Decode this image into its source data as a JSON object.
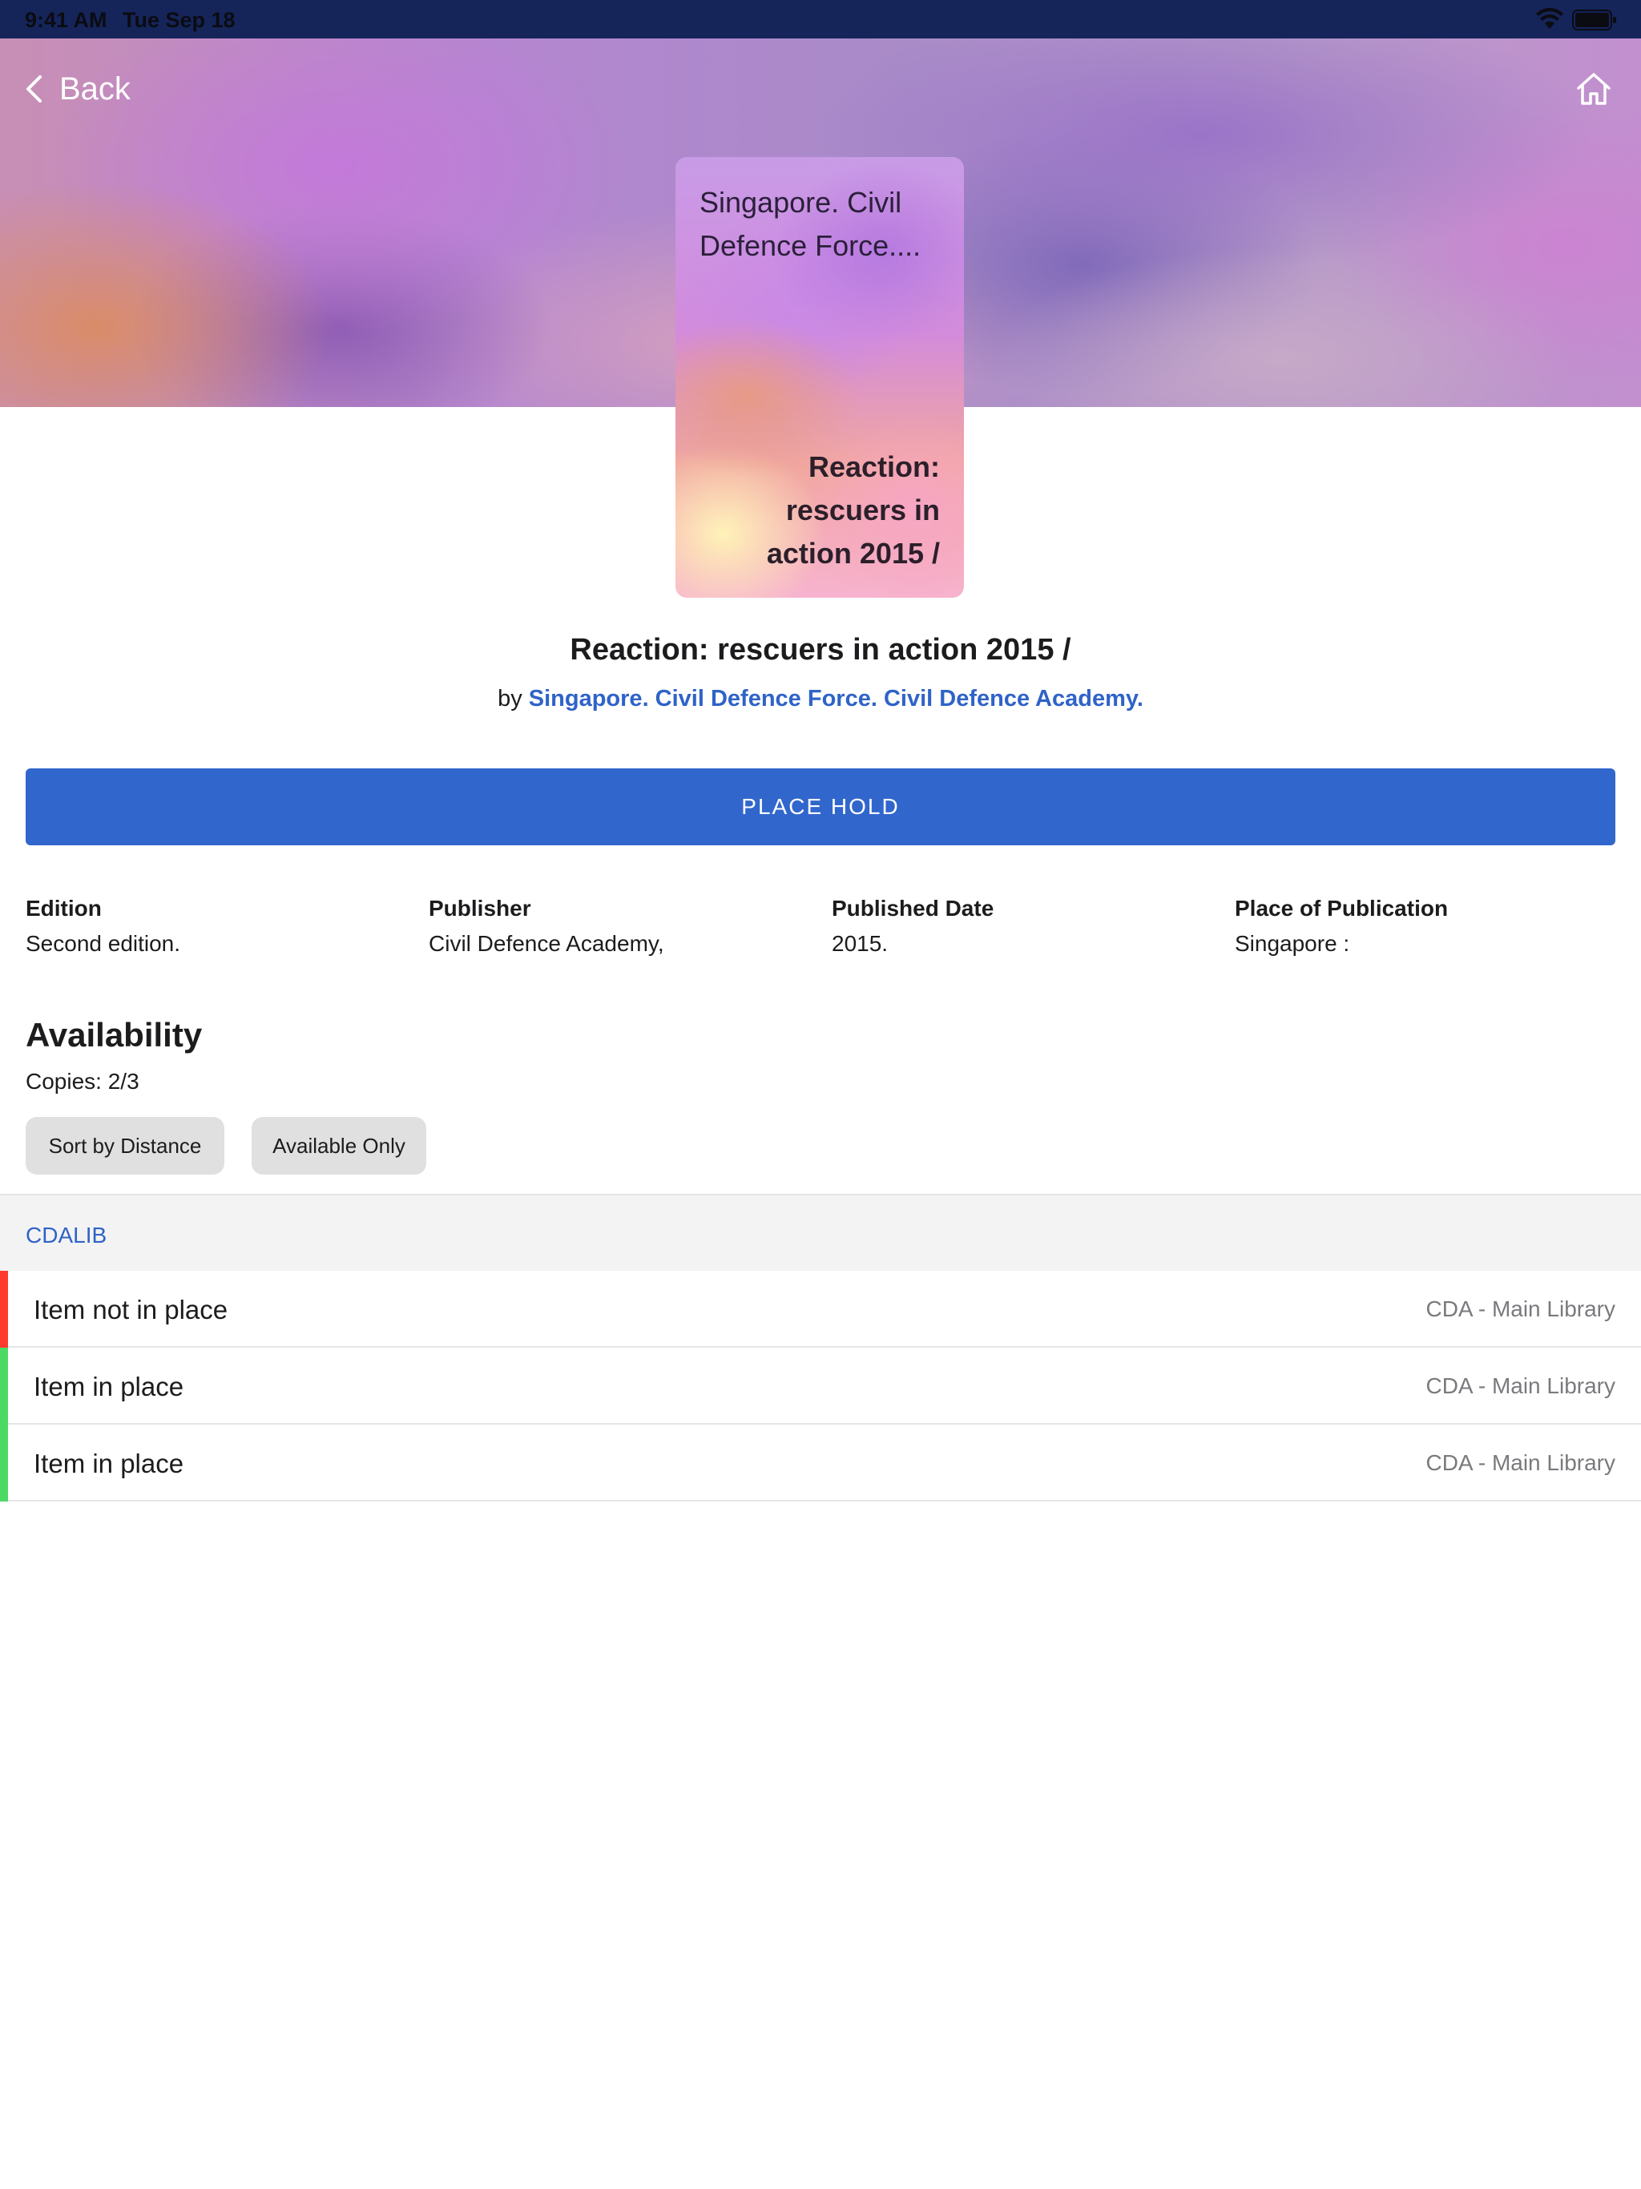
{
  "status_bar": {
    "time": "9:41 AM",
    "date": "Tue Sep 18"
  },
  "nav": {
    "back_label": "Back"
  },
  "cover": {
    "author_text": "Singapore. Civil Defence Force....",
    "title_text": "Reaction: rescuers in action 2015 /"
  },
  "book": {
    "title": "Reaction: rescuers in action 2015 /",
    "by_prefix": "by",
    "author": "Singapore. Civil Defence Force. Civil Defence Academy."
  },
  "actions": {
    "place_hold": "PLACE HOLD"
  },
  "details": [
    {
      "label": "Edition",
      "value": "Second edition."
    },
    {
      "label": "Publisher",
      "value": "Civil Defence Academy,"
    },
    {
      "label": "Published Date",
      "value": "2015."
    },
    {
      "label": "Place of Publication",
      "value": "Singapore :"
    }
  ],
  "availability": {
    "heading": "Availability",
    "copies": "Copies: 2/3",
    "filters": [
      "Sort by Distance",
      "Available Only"
    ],
    "location": "CDALIB",
    "items": [
      {
        "status": "Item not in place",
        "library": "CDA - Main Library",
        "color": "#ff3b30"
      },
      {
        "status": "Item in place",
        "library": "CDA - Main Library",
        "color": "#4cd964"
      },
      {
        "status": "Item in place",
        "library": "CDA - Main Library",
        "color": "#4cd964"
      }
    ]
  },
  "colors": {
    "accent": "#3166cc",
    "link": "#2f63c8",
    "status_bar": "#15255a"
  }
}
